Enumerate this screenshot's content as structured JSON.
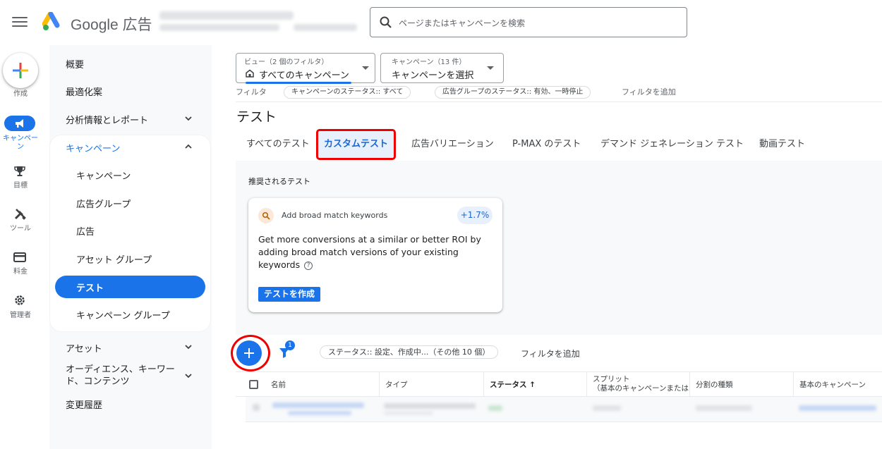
{
  "app": {
    "brand": "Google 広告",
    "search_placeholder": "ページまたはキャンペーンを検索"
  },
  "rail": {
    "create_label": "作成",
    "items": [
      {
        "label": "キャンペーン",
        "icon": "megaphone-icon",
        "active": true
      },
      {
        "label": "目標",
        "icon": "trophy-icon"
      },
      {
        "label": "ツール",
        "icon": "tools-icon"
      },
      {
        "label": "料金",
        "icon": "credit-card-icon"
      },
      {
        "label": "管理者",
        "icon": "gear-icon"
      }
    ]
  },
  "nav": {
    "overview": "概要",
    "recommendations": "最適化案",
    "insights": "分析情報とレポート",
    "campaigns_group": "キャンペーン",
    "sub": [
      "キャンペーン",
      "広告グループ",
      "広告",
      "アセット グループ",
      "テスト",
      "キャンペーン グループ"
    ],
    "selected": "テスト",
    "assets": "アセット",
    "audiences": "オーディエンス、キーワード、コンテンツ",
    "change_history": "変更履歴"
  },
  "view": {
    "caption": "ビュー（2 個のフィルタ）",
    "value": "すべてのキャンペーン"
  },
  "campaign_select": {
    "caption": "キャンペーン（13 件）",
    "value": "キャンペーンを選択"
  },
  "filters": {
    "label": "フィルタ",
    "chips": [
      "キャンペーンのステータス:: すべて",
      "広告グループのステータス:: 有効、一時停止"
    ],
    "add": "フィルタを追加"
  },
  "page_title": "テスト",
  "tabs": [
    "すべてのテスト",
    "カスタムテスト",
    "広告バリエーション",
    "P-MAX のテスト",
    "デマンド ジェネレーション テスト",
    "動画テスト"
  ],
  "active_tab": "カスタムテスト",
  "reco": {
    "section_title": "推奨されるテスト",
    "card_title": "Add broad match keywords",
    "badge": "+1.7%",
    "body": "Get more conversions at a similar or better ROI by adding broad match versions of your existing keywords",
    "button": "テストを作成"
  },
  "table": {
    "filter_count": "1",
    "status_chip": "ステータス:: 設定、作成中...（その他 10 個）",
    "add_filter": "フィルタを追加",
    "columns": [
      "名前",
      "タイプ",
      "ステータス ↑",
      "スプリット\n（基本のキャンペーンまたは",
      "分割の種類",
      "基本のキャンペーン"
    ]
  },
  "colors": {
    "accent": "#1a73e8",
    "highlight": "#ee0000"
  }
}
